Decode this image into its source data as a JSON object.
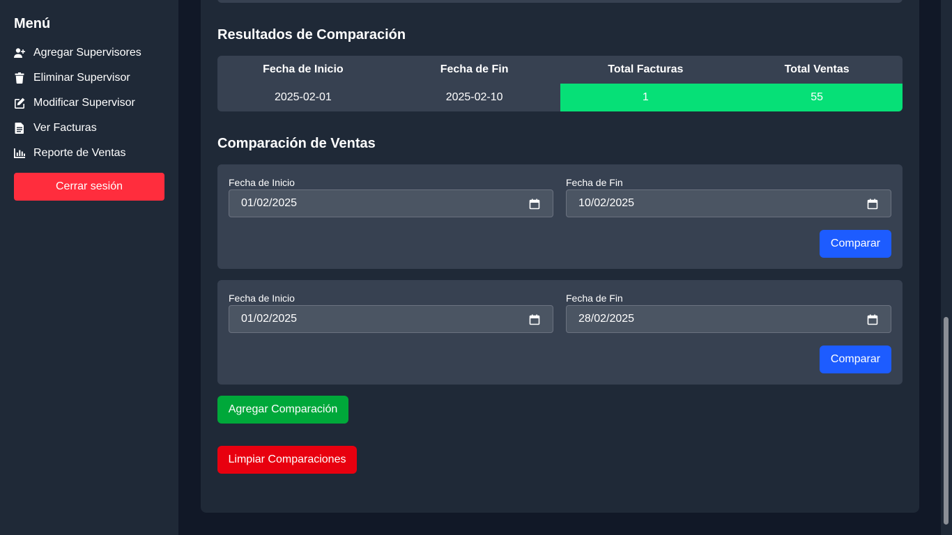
{
  "sidebar": {
    "title": "Menú",
    "items": [
      {
        "label": "Agregar Supervisores",
        "icon": "user-plus-icon"
      },
      {
        "label": "Eliminar Supervisor",
        "icon": "trash-icon"
      },
      {
        "label": "Modificar Supervisor",
        "icon": "edit-icon"
      },
      {
        "label": "Ver Facturas",
        "icon": "file-icon"
      },
      {
        "label": "Reporte de Ventas",
        "icon": "bar-chart-icon"
      }
    ],
    "logout_label": "Cerrar sesión"
  },
  "results": {
    "title": "Resultados de Comparación",
    "columns": [
      "Fecha de Inicio",
      "Fecha de Fin",
      "Total Facturas",
      "Total Ventas"
    ],
    "rows": [
      [
        "2025-02-01",
        "2025-02-10",
        "1",
        "55"
      ]
    ],
    "highlight_color": "#06e077"
  },
  "comparison": {
    "title": "Comparación de Ventas",
    "cards": [
      {
        "start_label": "Fecha de Inicio",
        "start_value": "01/02/2025",
        "end_label": "Fecha de Fin",
        "end_value": "10/02/2025",
        "button": "Comparar"
      },
      {
        "start_label": "Fecha de Inicio",
        "start_value": "01/02/2025",
        "end_label": "Fecha de Fin",
        "end_value": "28/02/2025",
        "button": "Comparar"
      }
    ],
    "add_label": "Agregar Comparación",
    "clear_label": "Limpiar Comparaciones"
  },
  "colors": {
    "primary": "#1d5cff",
    "success": "#00a83a",
    "danger": "#e8000f",
    "logout": "#ff2d3d"
  }
}
